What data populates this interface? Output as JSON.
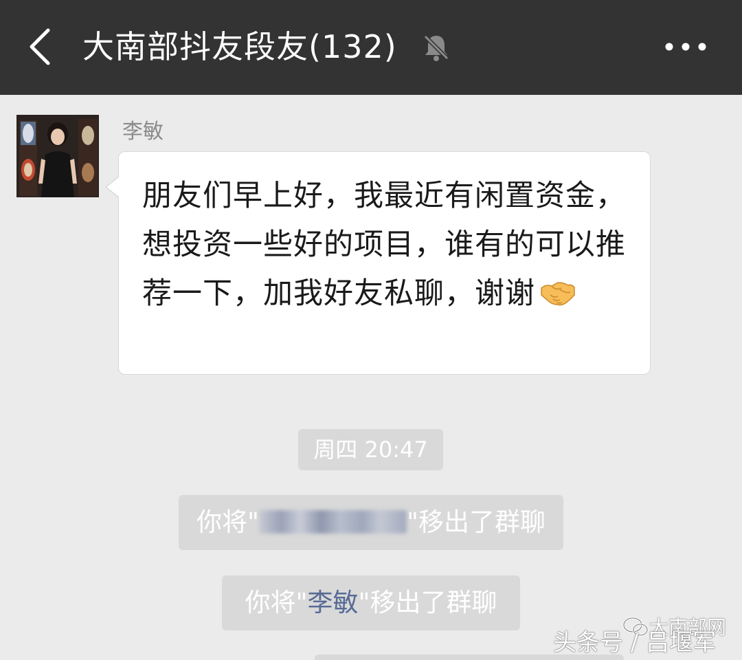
{
  "header": {
    "title": "大南部抖友段友(132)",
    "back_icon": "chevron-left-icon",
    "mute_icon": "bell-muted-icon",
    "more_icon": "ellipsis-icon",
    "background_color": "#333333"
  },
  "messages": [
    {
      "sender": "李敏",
      "text": "朋友们早上好，我最近有闲置资金，想投资一些好的项目，谁有的可以推荐一下，加我好友私聊，谢谢",
      "emoji": "handshake-emoji"
    }
  ],
  "system": {
    "timestamp": "周四 20:47",
    "removed_1": {
      "prefix": "你将\"",
      "name": "",
      "suffix": "\"移出了群聊"
    },
    "removed_2": {
      "prefix": "你将\"",
      "name": "李敏",
      "suffix": "\"移出了群聊"
    }
  },
  "watermark": {
    "brand": "大南部网",
    "source": "头条号 / 吕堰军"
  },
  "colors": {
    "chat_background": "#ebebeb",
    "system_bubble": "#d9d9d9",
    "link": "#576b95"
  }
}
